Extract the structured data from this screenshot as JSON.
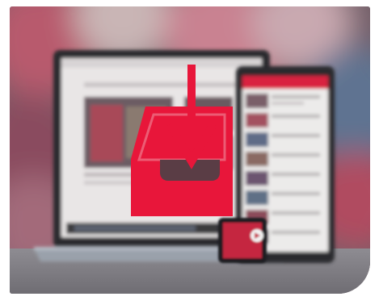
{
  "image": {
    "subject": "download-to-devices-illustration",
    "icon": "download-tray-icon",
    "colors": {
      "accent": "#e8163a",
      "laptop_body": "#2b2b2e",
      "laptop_base": "#9aa1ab",
      "tablet_body": "#2a2a2d",
      "phone_body": "#1e1e20",
      "screen_bg": "#e9e6e6",
      "background_blur_red": "#b7435a",
      "background_blur_blue": "#5e7391"
    }
  }
}
